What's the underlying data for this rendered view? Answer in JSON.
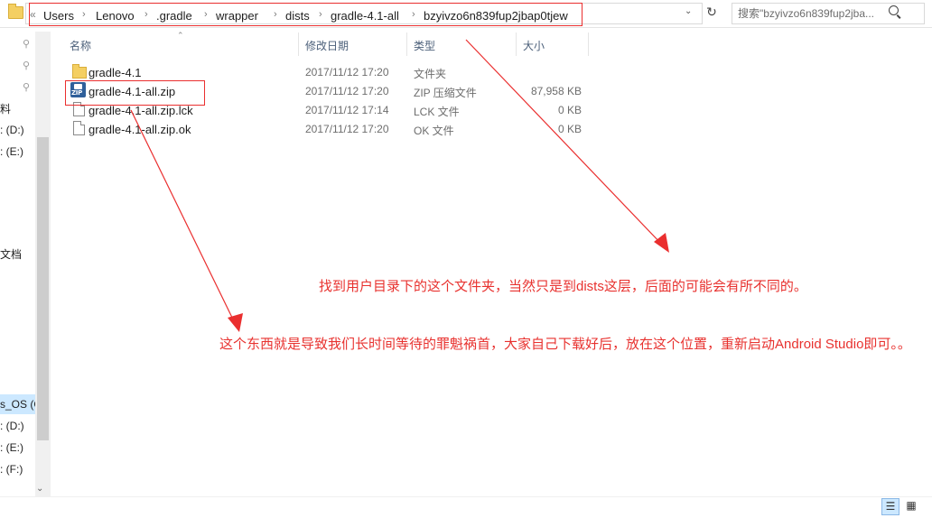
{
  "address": {
    "overflow": "«",
    "crumbs": [
      "Users",
      "Lenovo",
      ".gradle",
      "wrapper",
      "dists",
      "gradle-4.1-all",
      "bzyivzo6n839fup2jbap0tjew"
    ],
    "separator": "›",
    "dropdown_icon": "chevron-down-icon",
    "refresh_icon": "refresh-icon"
  },
  "search": {
    "placeholder": "搜索\"bzyivzo6n839fup2jba...",
    "icon": "search-icon"
  },
  "nav": {
    "items": [
      "料",
      ": (D:)",
      ": (E:)",
      "文档",
      "s_OS (C",
      ": (D:)",
      ": (E:)",
      ": (F:)"
    ]
  },
  "columns": {
    "name": "名称",
    "date": "修改日期",
    "type": "类型",
    "size": "大小"
  },
  "files": [
    {
      "name": "gradle-4.1",
      "date": "2017/11/12 17:20",
      "type": "文件夹",
      "size": "",
      "icon": "folder-icon"
    },
    {
      "name": "gradle-4.1-all.zip",
      "date": "2017/11/12 17:20",
      "type": "ZIP 压缩文件",
      "size": "87,958 KB",
      "icon": "zip-icon"
    },
    {
      "name": "gradle-4.1-all.zip.lck",
      "date": "2017/11/12 17:14",
      "type": "LCK 文件",
      "size": "0 KB",
      "icon": "file-icon"
    },
    {
      "name": "gradle-4.1-all.zip.ok",
      "date": "2017/11/12 17:20",
      "type": "OK 文件",
      "size": "0 KB",
      "icon": "file-icon"
    }
  ],
  "annotations": {
    "note1": "找到用户目录下的这个文件夹，当然只是到dists这层，后面的可能会有所不同的。",
    "note2": "这个东西就是导致我们长时间等待的罪魁祸首，大家自己下载好后，放在这个位置，重新启动Android Studio即可。。",
    "color": "#e8322f"
  }
}
